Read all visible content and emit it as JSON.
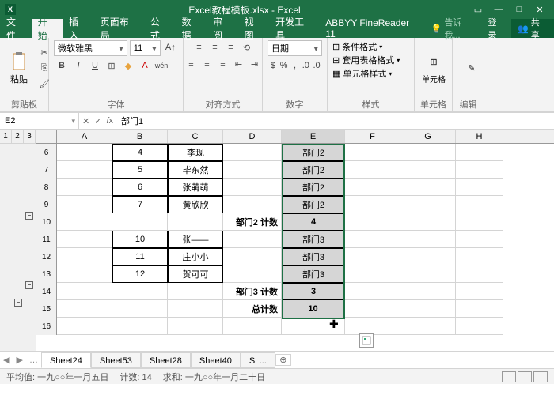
{
  "window": {
    "title": "Excel教程模板.xlsx - Excel"
  },
  "menus": {
    "file": "文件",
    "home": "开始",
    "insert": "插入",
    "layout": "页面布局",
    "formula": "公式",
    "data": "数据",
    "review": "审阅",
    "view": "视图",
    "dev": "开发工具",
    "abbyy": "ABBYY FineReader 11",
    "tell": "告诉我...",
    "login": "登录",
    "share": "共享"
  },
  "ribbon": {
    "clipboard": {
      "paste": "粘贴",
      "label": "剪贴板"
    },
    "font": {
      "name": "微软雅黑",
      "size": "11",
      "label": "字体"
    },
    "align": {
      "label": "对齐方式"
    },
    "number": {
      "format": "日期",
      "label": "数字"
    },
    "styles": {
      "cond": "条件格式",
      "table": "套用表格格式",
      "cell": "单元格样式",
      "label": "样式"
    },
    "cells": {
      "label": "单元格"
    },
    "editing": {
      "label": "编辑"
    }
  },
  "ref": {
    "name": "E2",
    "formula": "部门1"
  },
  "columns": [
    "A",
    "B",
    "C",
    "D",
    "E",
    "F",
    "G",
    "H"
  ],
  "rows": [
    {
      "n": "6",
      "b": "4",
      "c": "李现",
      "d": "",
      "e": "部门2"
    },
    {
      "n": "7",
      "b": "5",
      "c": "毕东然",
      "d": "",
      "e": "部门2"
    },
    {
      "n": "8",
      "b": "6",
      "c": "张萌萌",
      "d": "",
      "e": "部门2"
    },
    {
      "n": "9",
      "b": "7",
      "c": "黄欣欣",
      "d": "",
      "e": "部门2"
    },
    {
      "n": "10",
      "b": "",
      "c": "",
      "d": "部门2 计数",
      "e": "4",
      "sub": true
    },
    {
      "n": "11",
      "b": "10",
      "c": "张——",
      "d": "",
      "e": "部门3"
    },
    {
      "n": "12",
      "b": "11",
      "c": "庄小小",
      "d": "",
      "e": "部门3"
    },
    {
      "n": "13",
      "b": "12",
      "c": "贺可可",
      "d": "",
      "e": "部门3"
    },
    {
      "n": "14",
      "b": "",
      "c": "",
      "d": "部门3 计数",
      "e": "3",
      "sub": true
    },
    {
      "n": "15",
      "b": "",
      "c": "",
      "d": "总计数",
      "e": "10",
      "grand": true
    },
    {
      "n": "16",
      "b": "",
      "c": "",
      "d": "",
      "e": ""
    }
  ],
  "sheets": {
    "s1": "Sheet24",
    "s2": "Sheet53",
    "s3": "Sheet28",
    "s4": "Sheet40",
    "s5": "Sl ..."
  },
  "status": {
    "avg": "平均值: 一九○○年一月五日",
    "count": "计数: 14",
    "sum": "求和: 一九○○年一月二十日"
  },
  "outline": {
    "l1": "1",
    "l2": "2",
    "l3": "3"
  }
}
